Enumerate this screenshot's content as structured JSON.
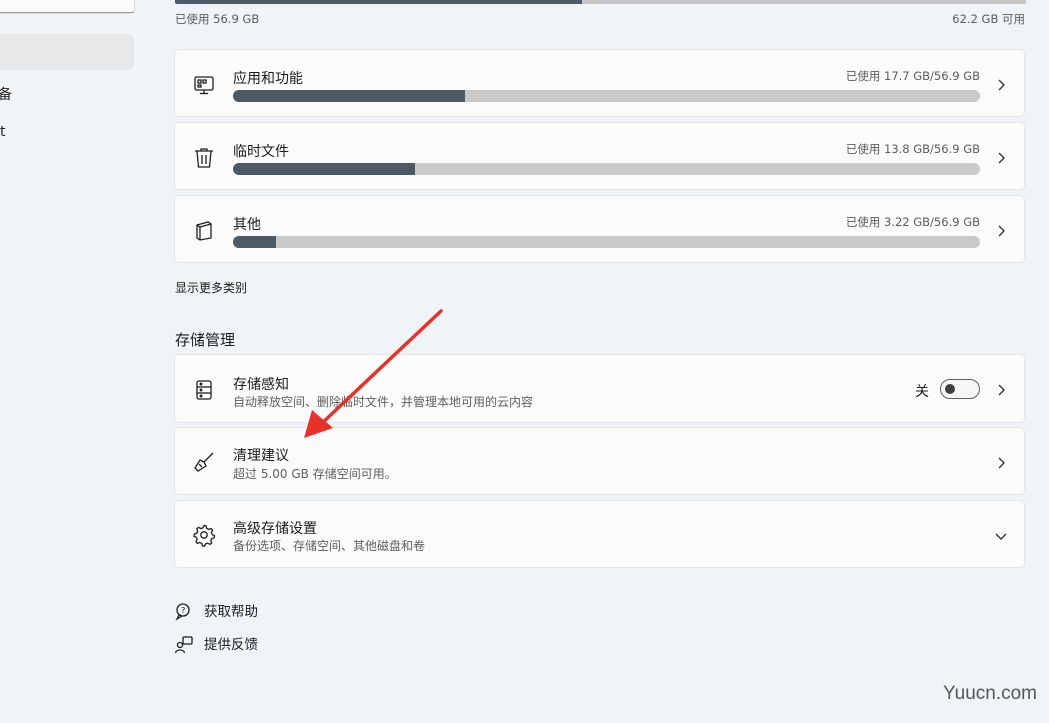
{
  "sidebar": {
    "item_a_text": "备",
    "item_b_text": "t"
  },
  "total": {
    "used_label": "已使用 56.9 GB",
    "free_label": "62.2 GB 可用",
    "used_fraction": 0.478
  },
  "categories": [
    {
      "title": "应用和功能",
      "used": "已使用 17.7 GB/56.9 GB",
      "icon": "apps-icon",
      "fraction": 0.311
    },
    {
      "title": "临时文件",
      "used": "已使用 13.8 GB/56.9 GB",
      "icon": "trash-icon",
      "fraction": 0.243
    },
    {
      "title": "其他",
      "used": "已使用 3.22 GB/56.9 GB",
      "icon": "document-icon",
      "fraction": 0.057
    }
  ],
  "show_more": "显示更多类别",
  "storage_management": {
    "title": "存储管理",
    "storage_sense": {
      "title": "存储感知",
      "sub": "自动释放空间、删除临时文件，并管理本地可用的云内容",
      "toggle_label": "关",
      "toggle_on": false
    },
    "cleanup": {
      "title": "清理建议",
      "sub": "超过 5.00 GB 存储空间可用。"
    },
    "advanced": {
      "title": "高级存储设置",
      "sub": "备份选项、存储空间、其他磁盘和卷"
    }
  },
  "help": {
    "get_help": "获取帮助",
    "feedback": "提供反馈"
  },
  "watermark": "Yuucn.com",
  "colors": {
    "bar_fill": "#4c5a66",
    "bar_track": "#c9c9c9",
    "arrow": "#e8312a"
  }
}
